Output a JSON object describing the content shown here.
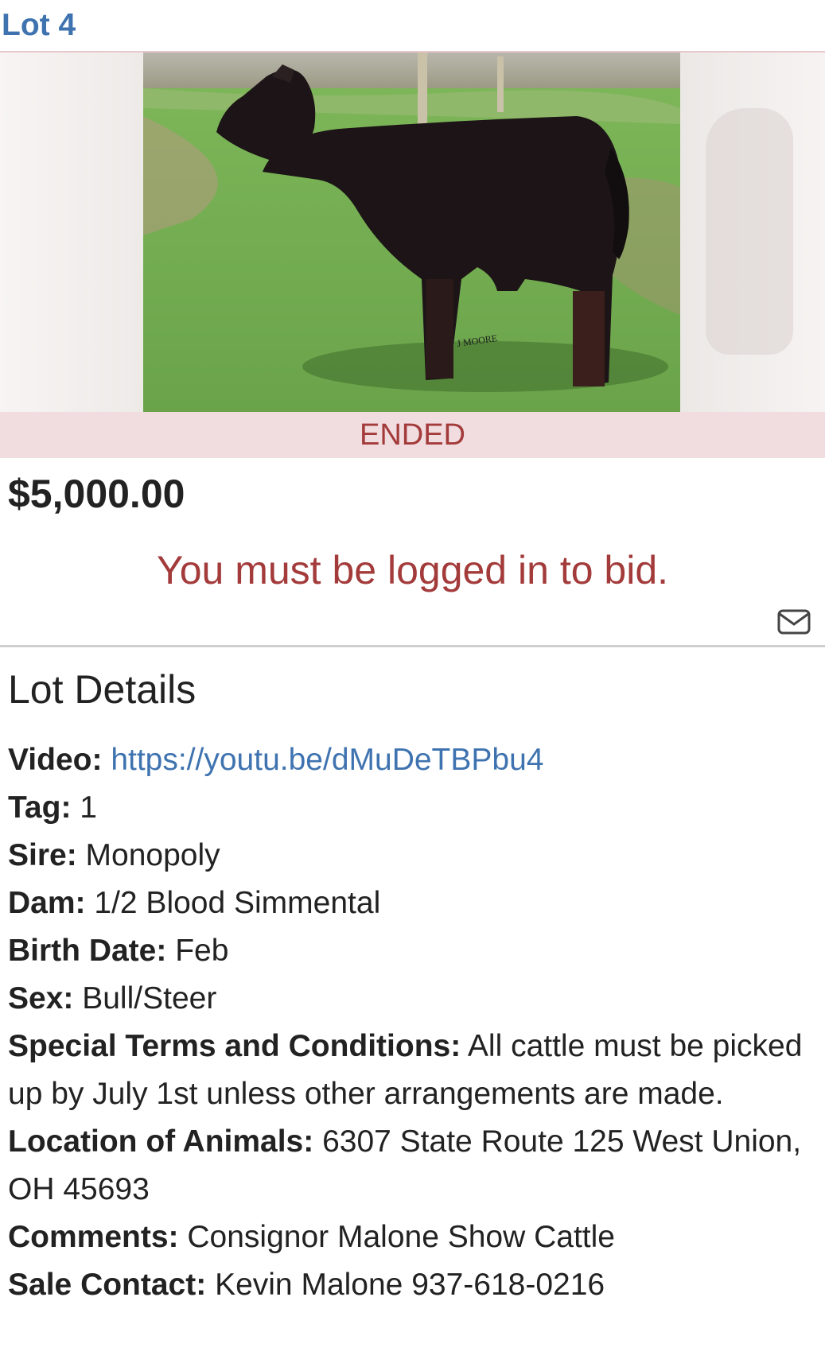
{
  "lot": {
    "title": "Lot 4"
  },
  "gallery": {
    "image_watermark": "J MOORE",
    "active_slide": 1
  },
  "status": {
    "label": "ENDED"
  },
  "price": "$5,000.00",
  "login_message": "You must be logged in to bid.",
  "icons": {
    "mail": "mail-icon"
  },
  "colors": {
    "accent": "#3f73b0",
    "status_bg": "#f1dde0",
    "status_text": "#a43b3b"
  },
  "details": {
    "heading": "Lot Details",
    "rows": [
      {
        "label": "Video:",
        "value": "https://youtu.be/dMuDeTBPbu4"
      },
      {
        "label": "Tag:",
        "value": "1"
      },
      {
        "label": "Sire:",
        "value": "Monopoly"
      },
      {
        "label": "Dam:",
        "value": "1/2 Blood Simmental"
      },
      {
        "label": "Birth Date:",
        "value": "Feb"
      },
      {
        "label": "Sex:",
        "value": "Bull/Steer"
      },
      {
        "label": "Special Terms and Conditions:",
        "value": "All cattle must be picked up by July 1st unless other arrangements are made."
      },
      {
        "label": "Location of Animals:",
        "value": "6307 State Route 125 West Union, OH 45693"
      },
      {
        "label": "Comments:",
        "value": "Consignor Malone Show Cattle"
      },
      {
        "label": "Sale Contact:",
        "value": "Kevin Malone 937-618-0216"
      }
    ]
  }
}
